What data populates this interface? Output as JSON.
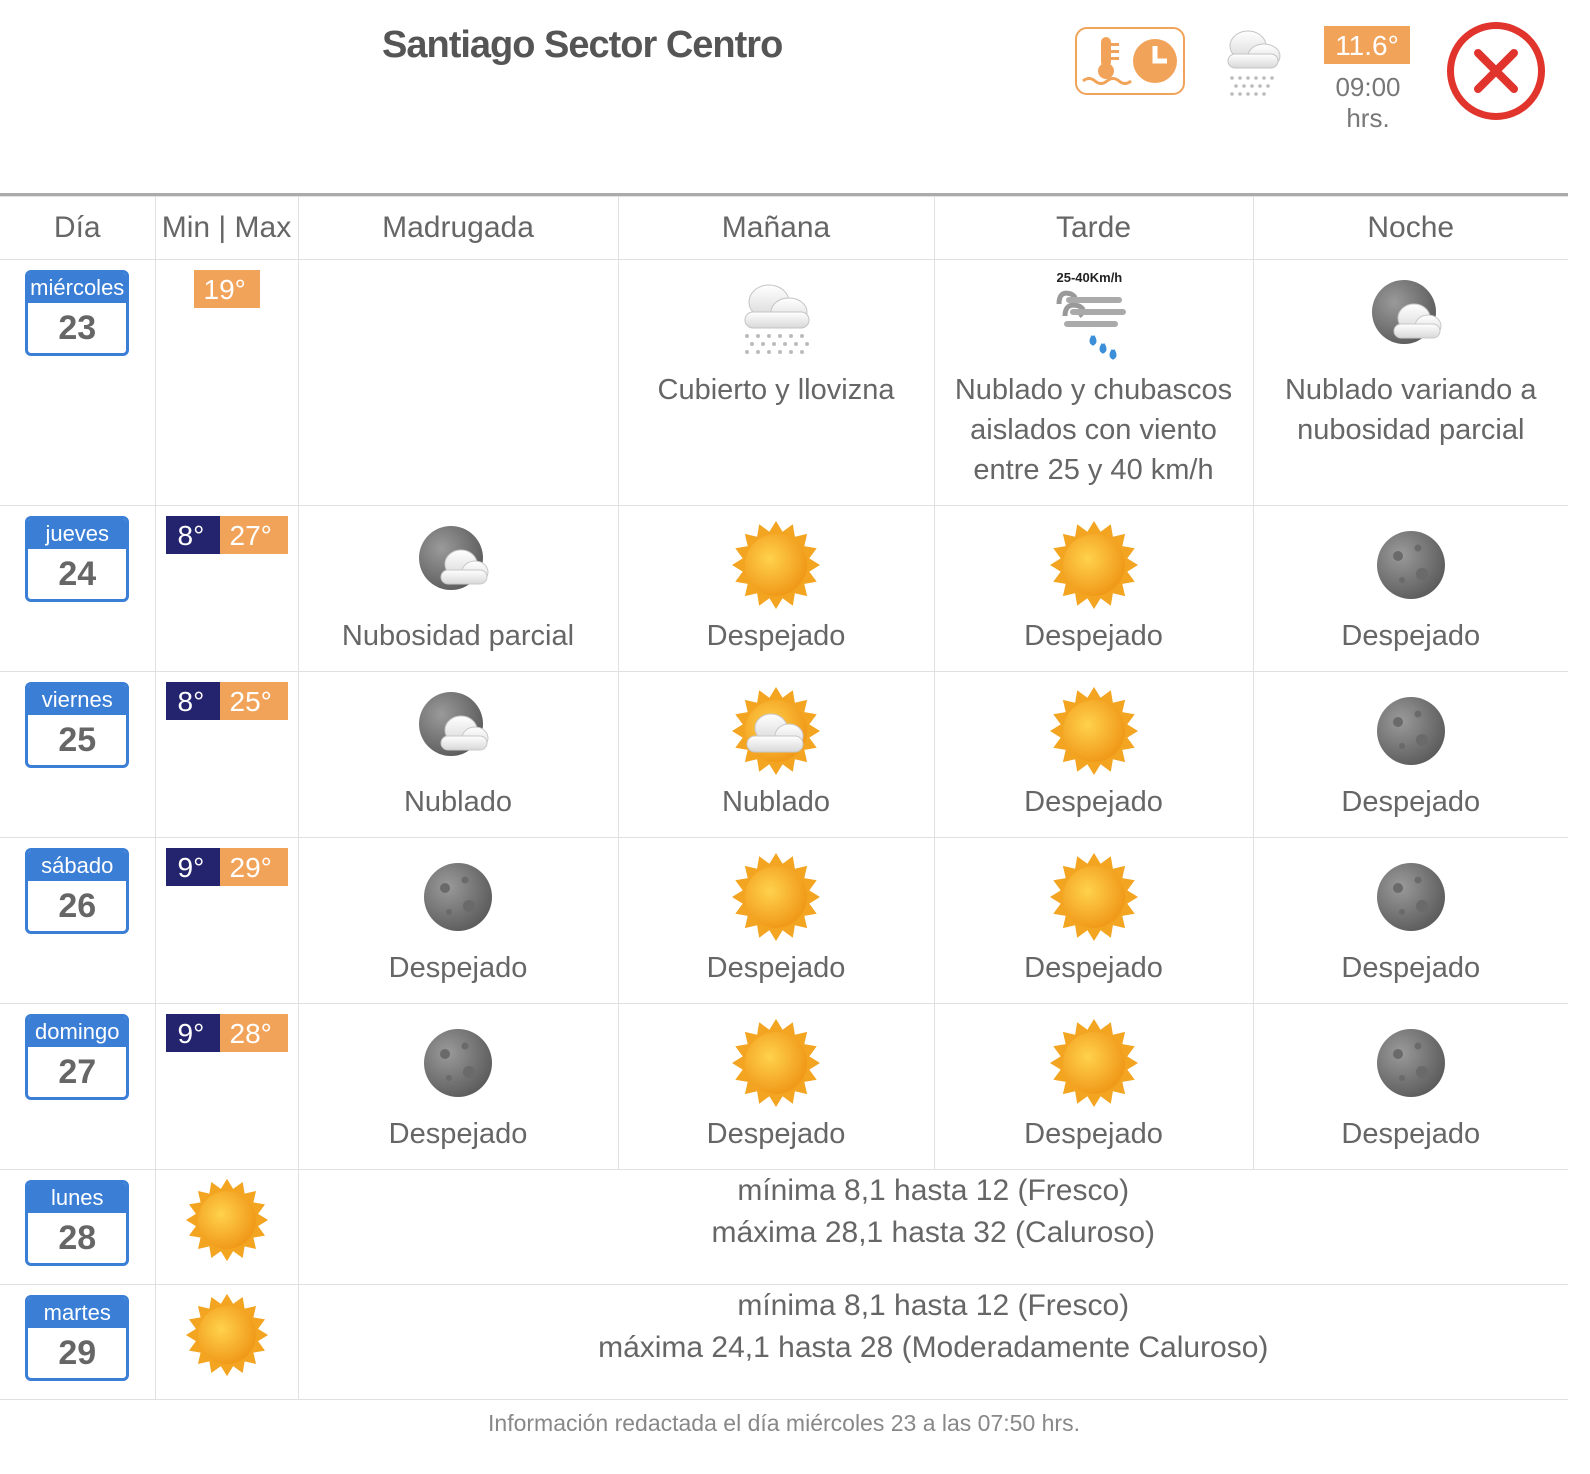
{
  "header": {
    "title": "Santiago Sector Centro",
    "current_temp": "11.6°",
    "current_time": "09:00 hrs.",
    "current_icon": "drizzle-icon",
    "temp_time_icon": "thermometer-clock-icon",
    "close_icon": "close-icon"
  },
  "columns": [
    "Día",
    "Min | Max",
    "Madrugada",
    "Mañana",
    "Tarde",
    "Noche"
  ],
  "days": [
    {
      "name": "miércoles",
      "num": "23",
      "min": "",
      "max": "19°",
      "periods": [
        {
          "icon": "",
          "text": ""
        },
        {
          "icon": "drizzle-icon",
          "text": "Cubierto y llovizna"
        },
        {
          "icon": "wind-rain-icon",
          "badge": "25-40Km/h",
          "text": "Nublado y chubascos aislados con viento entre 25 y 40 km/h"
        },
        {
          "icon": "night-cloud-icon",
          "text": "Nublado variando a nubosidad parcial"
        }
      ]
    },
    {
      "name": "jueves",
      "num": "24",
      "min": "8°",
      "max": "27°",
      "periods": [
        {
          "icon": "night-cloud-icon",
          "text": "Nubosidad parcial"
        },
        {
          "icon": "sun-icon",
          "text": "Despejado"
        },
        {
          "icon": "sun-icon",
          "text": "Despejado"
        },
        {
          "icon": "moon-icon",
          "text": "Despejado"
        }
      ]
    },
    {
      "name": "viernes",
      "num": "25",
      "min": "8°",
      "max": "25°",
      "periods": [
        {
          "icon": "night-cloud-icon",
          "text": "Nublado"
        },
        {
          "icon": "sun-cloud-icon",
          "text": "Nublado"
        },
        {
          "icon": "sun-icon",
          "text": "Despejado"
        },
        {
          "icon": "moon-icon",
          "text": "Despejado"
        }
      ]
    },
    {
      "name": "sábado",
      "num": "26",
      "min": "9°",
      "max": "29°",
      "periods": [
        {
          "icon": "moon-icon",
          "text": "Despejado"
        },
        {
          "icon": "sun-icon",
          "text": "Despejado"
        },
        {
          "icon": "sun-icon",
          "text": "Despejado"
        },
        {
          "icon": "moon-icon",
          "text": "Despejado"
        }
      ]
    },
    {
      "name": "domingo",
      "num": "27",
      "min": "9°",
      "max": "28°",
      "periods": [
        {
          "icon": "moon-icon",
          "text": "Despejado"
        },
        {
          "icon": "sun-icon",
          "text": "Despejado"
        },
        {
          "icon": "sun-icon",
          "text": "Despejado"
        },
        {
          "icon": "moon-icon",
          "text": "Despejado"
        }
      ]
    }
  ],
  "extended": [
    {
      "name": "lunes",
      "num": "28",
      "icon": "sun-icon",
      "line1": "mínima 8,1 hasta 12 (Fresco)",
      "line2": "máxima 28,1 hasta 32 (Caluroso)"
    },
    {
      "name": "martes",
      "num": "29",
      "icon": "sun-icon",
      "line1": "mínima 8,1 hasta 12 (Fresco)",
      "line2": "máxima 24,1 hasta 28 (Moderadamente Caluroso)"
    }
  ],
  "footer": "Información redactada el día miércoles 23 a las 07:50 hrs.",
  "colors": {
    "accent_orange": "#f2a35a",
    "min_blue": "#24246e",
    "day_blue": "#3a7ed6",
    "close_red": "#e0342d"
  }
}
